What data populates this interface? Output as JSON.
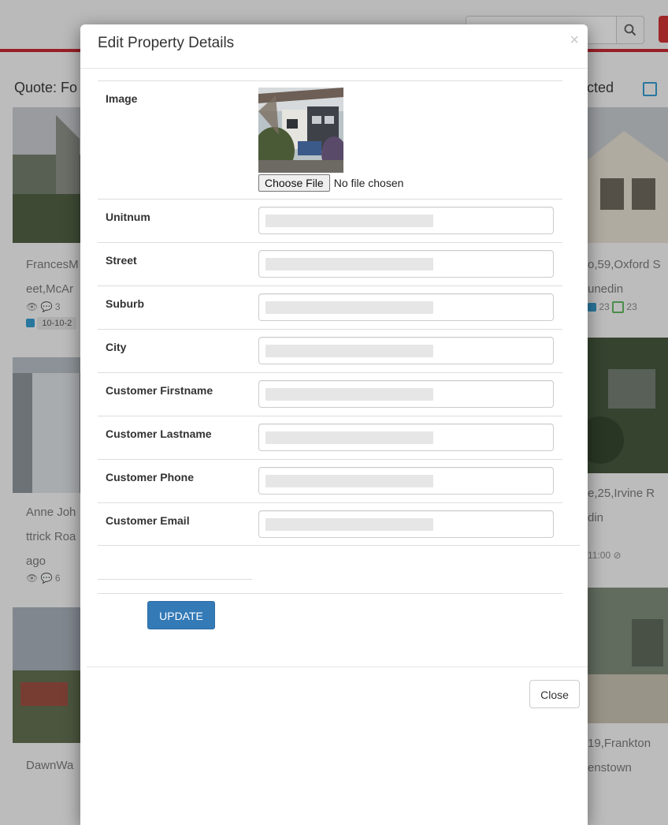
{
  "background": {
    "heading_left": "Quote: Fo",
    "heading_right": "cted",
    "search_icon": "search-icon",
    "cards": [
      {
        "line1": "FrancesM",
        "line2": "eet,McAr",
        "meta_comments": "3",
        "meta_date": "10-10-2"
      },
      {
        "line1": "o,59,Oxford S",
        "line2": "unedin",
        "meta_count_a": "23",
        "meta_count_b": "23"
      },
      {
        "line1": "Anne Joh",
        "line2": "ttrick Roa",
        "line3": "ago",
        "meta_comments": "6"
      },
      {
        "line1": "e,25,Irvine R",
        "line2": "din",
        "meta_time": "11:00"
      },
      {
        "line1": "DawnWa"
      },
      {
        "line1": "19,Frankton",
        "line2": "enstown"
      }
    ]
  },
  "modal": {
    "title": "Edit Property Details",
    "close_x": "×",
    "fields": {
      "image": "Image",
      "unitnum": "Unitnum",
      "street": "Street",
      "suburb": "Suburb",
      "city": "City",
      "customer_firstname": "Customer Firstname",
      "customer_lastname": "Customer Lastname",
      "customer_phone": "Customer Phone",
      "customer_email": "Customer Email"
    },
    "file_input": {
      "button_label": "Choose File",
      "status": "No file chosen"
    },
    "update_label": "UPDATE",
    "close_label": "Close"
  }
}
